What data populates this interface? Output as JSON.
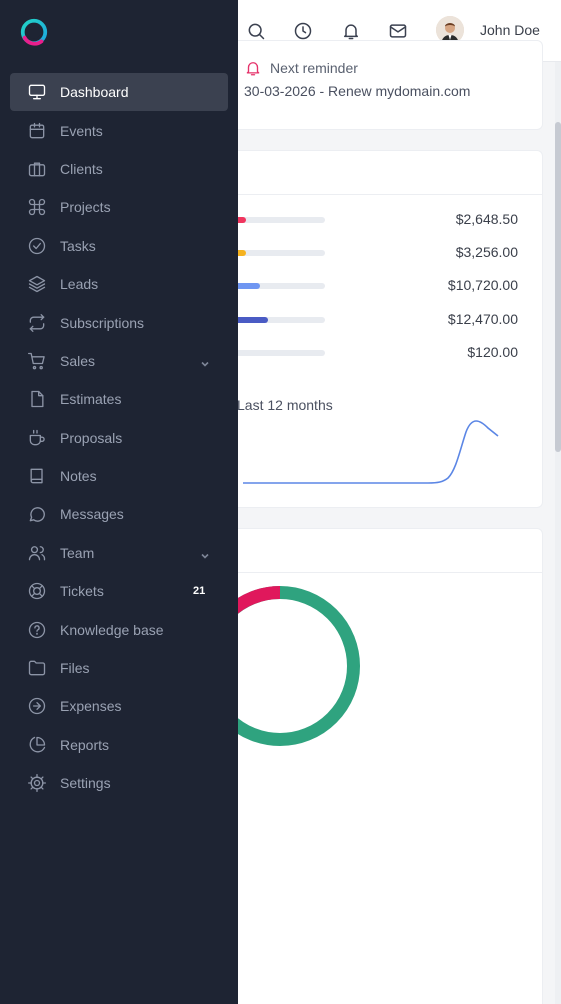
{
  "header": {
    "user_name": "John Doe",
    "icons": [
      "close-icon",
      "search-icon",
      "clock-icon",
      "bell-icon",
      "mail-icon"
    ]
  },
  "reminder": {
    "title": "Next reminder",
    "text": "30-03-2026 - Renew mydomain.com",
    "icon_color": "#e5326a"
  },
  "finance": {
    "rows": [
      {
        "amount": "$2,648.50",
        "fill": 0.12,
        "color": "#f0355e"
      },
      {
        "amount": "$3,256.00",
        "fill": 0.12,
        "color": "#f5b21f"
      },
      {
        "amount": "$10,720.00",
        "fill": 0.28,
        "color": "#6f96f2"
      },
      {
        "amount": "$12,470.00",
        "fill": 0.37,
        "color": "#4a5bc4"
      },
      {
        "amount": "$120.00",
        "fill": 0.0,
        "color": "#9aa2b3"
      }
    ],
    "period": "Last 12 months",
    "line_color": "#5b86e5"
  },
  "donut": {
    "segments": [
      {
        "color": "#e0185c",
        "fraction": 0.2
      },
      {
        "color": "#2fa37f",
        "fraction": 0.8
      }
    ]
  },
  "sidebar": {
    "items": [
      {
        "label": "Dashboard",
        "icon": "monitor-icon",
        "active": true
      },
      {
        "label": "Events",
        "icon": "calendar-icon"
      },
      {
        "label": "Clients",
        "icon": "briefcase-icon"
      },
      {
        "label": "Projects",
        "icon": "command-icon"
      },
      {
        "label": "Tasks",
        "icon": "check-circle-icon"
      },
      {
        "label": "Leads",
        "icon": "layers-icon"
      },
      {
        "label": "Subscriptions",
        "icon": "repeat-icon"
      },
      {
        "label": "Sales",
        "icon": "cart-icon",
        "chevron": true
      },
      {
        "label": "Estimates",
        "icon": "file-icon"
      },
      {
        "label": "Proposals",
        "icon": "coffee-icon"
      },
      {
        "label": "Notes",
        "icon": "book-icon"
      },
      {
        "label": "Messages",
        "icon": "message-icon"
      },
      {
        "label": "Team",
        "icon": "users-icon",
        "chevron": true
      },
      {
        "label": "Tickets",
        "icon": "life-buoy-icon",
        "badge": "21"
      },
      {
        "label": "Knowledge base",
        "icon": "help-circle-icon"
      },
      {
        "label": "Files",
        "icon": "folder-icon"
      },
      {
        "label": "Expenses",
        "icon": "arrow-circle-icon"
      },
      {
        "label": "Reports",
        "icon": "pie-chart-icon"
      },
      {
        "label": "Settings",
        "icon": "settings-icon"
      }
    ]
  }
}
